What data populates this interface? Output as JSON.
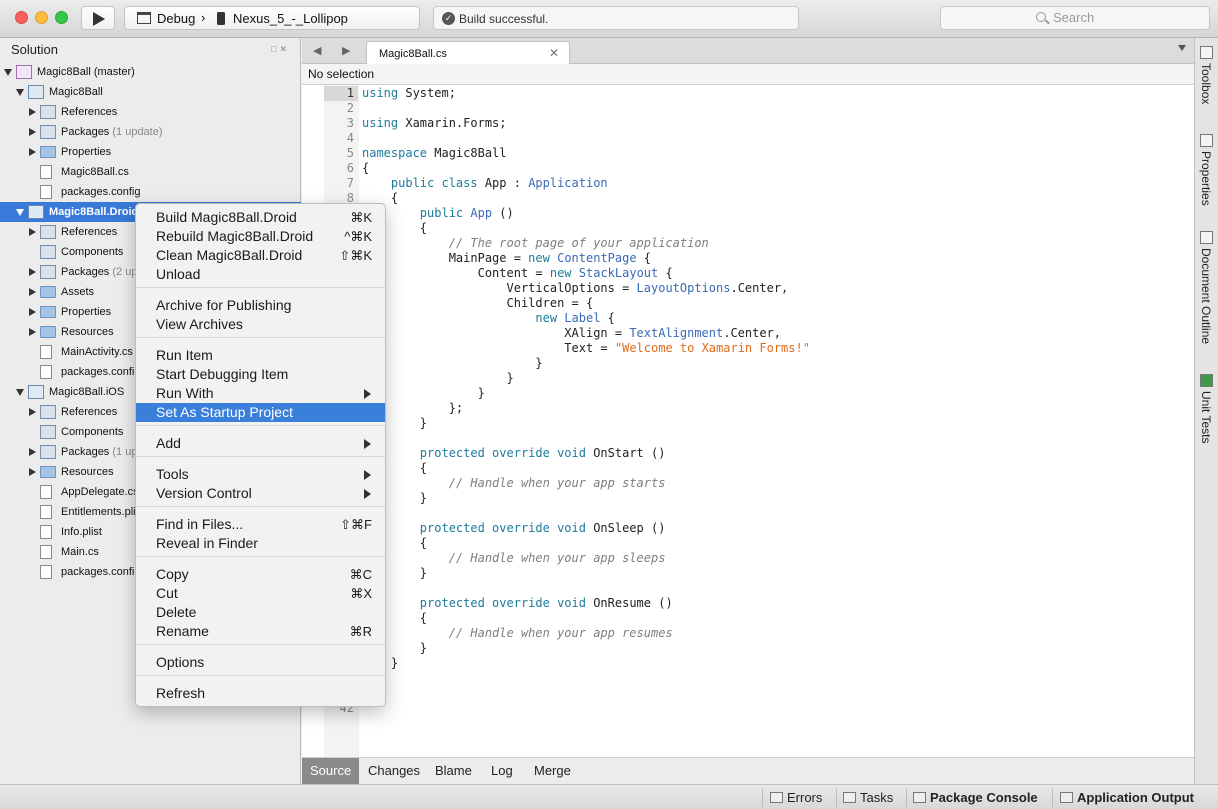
{
  "toolbar": {
    "config": "Debug",
    "separator": "›",
    "device": "Nexus_5_-_Lollipop",
    "status": "Build successful.",
    "search_placeholder": "Search"
  },
  "solution_pad": {
    "title": "Solution",
    "rows": [
      {
        "label": "Magic8Ball (master)",
        "note": ""
      },
      {
        "label": "Magic8Ball",
        "note": ""
      },
      {
        "label": "References",
        "note": ""
      },
      {
        "label": "Packages",
        "note": "(1 update)"
      },
      {
        "label": "Properties",
        "note": ""
      },
      {
        "label": "Magic8Ball.cs",
        "note": ""
      },
      {
        "label": "packages.config",
        "note": ""
      },
      {
        "label": "Magic8Ball.Droid",
        "note": ""
      },
      {
        "label": "References",
        "note": ""
      },
      {
        "label": "Components",
        "note": ""
      },
      {
        "label": "Packages",
        "note": "(2 up"
      },
      {
        "label": "Assets",
        "note": ""
      },
      {
        "label": "Properties",
        "note": ""
      },
      {
        "label": "Resources",
        "note": ""
      },
      {
        "label": "MainActivity.cs",
        "note": ""
      },
      {
        "label": "packages.config",
        "note": ""
      },
      {
        "label": "Magic8Ball.iOS",
        "note": ""
      },
      {
        "label": "References",
        "note": ""
      },
      {
        "label": "Components",
        "note": ""
      },
      {
        "label": "Packages",
        "note": "(1 up"
      },
      {
        "label": "Resources",
        "note": ""
      },
      {
        "label": "AppDelegate.cs",
        "note": ""
      },
      {
        "label": "Entitlements.plis",
        "note": ""
      },
      {
        "label": "Info.plist",
        "note": ""
      },
      {
        "label": "Main.cs",
        "note": ""
      },
      {
        "label": "packages.config",
        "note": ""
      }
    ]
  },
  "editor": {
    "tab_label": "Magic8Ball.cs",
    "tab_close": "✕",
    "path": "No selection",
    "lines": [
      {
        "n": "1",
        "t": [
          [
            "kw",
            "using"
          ],
          [
            "tx",
            " System;"
          ]
        ]
      },
      {
        "n": "2",
        "t": []
      },
      {
        "n": "3",
        "t": [
          [
            "kw",
            "using"
          ],
          [
            "tx",
            " Xamarin.Forms;"
          ]
        ]
      },
      {
        "n": "4",
        "t": []
      },
      {
        "n": "5",
        "t": [
          [
            "kw",
            "namespace"
          ],
          [
            "tx",
            " Magic8Ball"
          ]
        ]
      },
      {
        "n": "6",
        "t": [
          [
            "tx",
            "{"
          ]
        ]
      },
      {
        "n": "7",
        "t": [
          [
            "tx",
            "    "
          ],
          [
            "kw",
            "public class"
          ],
          [
            "tx",
            " App : "
          ],
          [
            "ty",
            "Application"
          ]
        ]
      },
      {
        "n": "8",
        "t": [
          [
            "tx",
            "    {"
          ]
        ]
      },
      {
        "n": "",
        "t": [
          [
            "tx",
            "        "
          ],
          [
            "kw",
            "public"
          ],
          [
            "tx",
            " "
          ],
          [
            "ty",
            "App"
          ],
          [
            "tx",
            " ()"
          ]
        ]
      },
      {
        "n": "",
        "t": [
          [
            "tx",
            "        {"
          ]
        ]
      },
      {
        "n": "",
        "t": [
          [
            "cm",
            "            // The root page of your application"
          ]
        ]
      },
      {
        "n": "",
        "t": [
          [
            "tx",
            "            MainPage = "
          ],
          [
            "kw",
            "new"
          ],
          [
            "tx",
            " "
          ],
          [
            "ty",
            "ContentPage"
          ],
          [
            "tx",
            " {"
          ]
        ]
      },
      {
        "n": "",
        "t": [
          [
            "tx",
            "                Content = "
          ],
          [
            "kw",
            "new"
          ],
          [
            "tx",
            " "
          ],
          [
            "ty",
            "StackLayout"
          ],
          [
            "tx",
            " {"
          ]
        ]
      },
      {
        "n": "",
        "t": [
          [
            "tx",
            "                    VerticalOptions = "
          ],
          [
            "ty",
            "LayoutOptions"
          ],
          [
            "tx",
            ".Center,"
          ]
        ]
      },
      {
        "n": "",
        "t": [
          [
            "tx",
            "                    Children = {"
          ]
        ]
      },
      {
        "n": "",
        "t": [
          [
            "tx",
            "                        "
          ],
          [
            "kw",
            "new"
          ],
          [
            "tx",
            " "
          ],
          [
            "ty",
            "Label"
          ],
          [
            "tx",
            " {"
          ]
        ]
      },
      {
        "n": "",
        "t": [
          [
            "tx",
            "                            XAlign = "
          ],
          [
            "ty",
            "TextAlignment"
          ],
          [
            "tx",
            ".Center,"
          ]
        ]
      },
      {
        "n": "",
        "t": [
          [
            "tx",
            "                            Text = "
          ],
          [
            "st",
            "\"Welcome to Xamarin Forms!\""
          ]
        ]
      },
      {
        "n": "",
        "t": [
          [
            "tx",
            "                        }"
          ]
        ]
      },
      {
        "n": "",
        "t": [
          [
            "tx",
            "                    }"
          ]
        ]
      },
      {
        "n": "",
        "t": [
          [
            "tx",
            "                }"
          ]
        ]
      },
      {
        "n": "",
        "t": [
          [
            "tx",
            "            };"
          ]
        ]
      },
      {
        "n": "",
        "t": [
          [
            "tx",
            "        }"
          ]
        ]
      },
      {
        "n": "",
        "t": []
      },
      {
        "n": "",
        "t": [
          [
            "tx",
            "        "
          ],
          [
            "kw",
            "protected override void"
          ],
          [
            "tx",
            " OnStart ()"
          ]
        ]
      },
      {
        "n": "",
        "t": [
          [
            "tx",
            "        {"
          ]
        ]
      },
      {
        "n": "",
        "t": [
          [
            "cm",
            "            // Handle when your app starts"
          ]
        ]
      },
      {
        "n": "",
        "t": [
          [
            "tx",
            "        }"
          ]
        ]
      },
      {
        "n": "",
        "t": []
      },
      {
        "n": "",
        "t": [
          [
            "tx",
            "        "
          ],
          [
            "kw",
            "protected override void"
          ],
          [
            "tx",
            " OnSleep ()"
          ]
        ]
      },
      {
        "n": "",
        "t": [
          [
            "tx",
            "        {"
          ]
        ]
      },
      {
        "n": "",
        "t": [
          [
            "cm",
            "            // Handle when your app sleeps"
          ]
        ]
      },
      {
        "n": "",
        "t": [
          [
            "tx",
            "        }"
          ]
        ]
      },
      {
        "n": "",
        "t": []
      },
      {
        "n": "",
        "t": [
          [
            "tx",
            "        "
          ],
          [
            "kw",
            "protected override void"
          ],
          [
            "tx",
            " OnResume ()"
          ]
        ]
      },
      {
        "n": "",
        "t": [
          [
            "tx",
            "        {"
          ]
        ]
      },
      {
        "n": "",
        "t": [
          [
            "cm",
            "            // Handle when your app resumes"
          ]
        ]
      },
      {
        "n": "",
        "t": [
          [
            "tx",
            "        }"
          ]
        ]
      },
      {
        "n": "",
        "t": [
          [
            "tx",
            "    }"
          ]
        ]
      },
      {
        "n": "",
        "t": []
      },
      {
        "n": "",
        "t": []
      },
      {
        "n": "42",
        "t": []
      }
    ]
  },
  "bottom_tabs": [
    "Source",
    "Changes",
    "Blame",
    "Log",
    "Merge"
  ],
  "statusbar": {
    "errors": "Errors",
    "tasks": "Tasks",
    "package_console": "Package Console",
    "app_output": "Application Output"
  },
  "right_dock": [
    "Toolbox",
    "Properties",
    "Document Outline",
    "Unit Tests"
  ],
  "context_menu": {
    "items": [
      {
        "label": "Build Magic8Ball.Droid",
        "shortcut": "⌘K"
      },
      {
        "label": "Rebuild Magic8Ball.Droid",
        "shortcut": "^⌘K"
      },
      {
        "label": "Clean Magic8Ball.Droid",
        "shortcut": "⇧⌘K"
      },
      {
        "label": "Unload",
        "shortcut": ""
      },
      {
        "label": "Archive for Publishing",
        "shortcut": ""
      },
      {
        "label": "View Archives",
        "shortcut": ""
      },
      {
        "label": "Run Item",
        "shortcut": ""
      },
      {
        "label": "Start Debugging Item",
        "shortcut": ""
      },
      {
        "label": "Run With",
        "shortcut": ""
      },
      {
        "label": "Set As Startup Project",
        "shortcut": ""
      },
      {
        "label": "Add",
        "shortcut": ""
      },
      {
        "label": "Tools",
        "shortcut": ""
      },
      {
        "label": "Version Control",
        "shortcut": ""
      },
      {
        "label": "Find in Files...",
        "shortcut": "⇧⌘F"
      },
      {
        "label": "Reveal in Finder",
        "shortcut": ""
      },
      {
        "label": "Copy",
        "shortcut": "⌘C"
      },
      {
        "label": "Cut",
        "shortcut": "⌘X"
      },
      {
        "label": "Delete",
        "shortcut": ""
      },
      {
        "label": "Rename",
        "shortcut": "⌘R"
      },
      {
        "label": "Options",
        "shortcut": ""
      },
      {
        "label": "Refresh",
        "shortcut": ""
      }
    ]
  }
}
